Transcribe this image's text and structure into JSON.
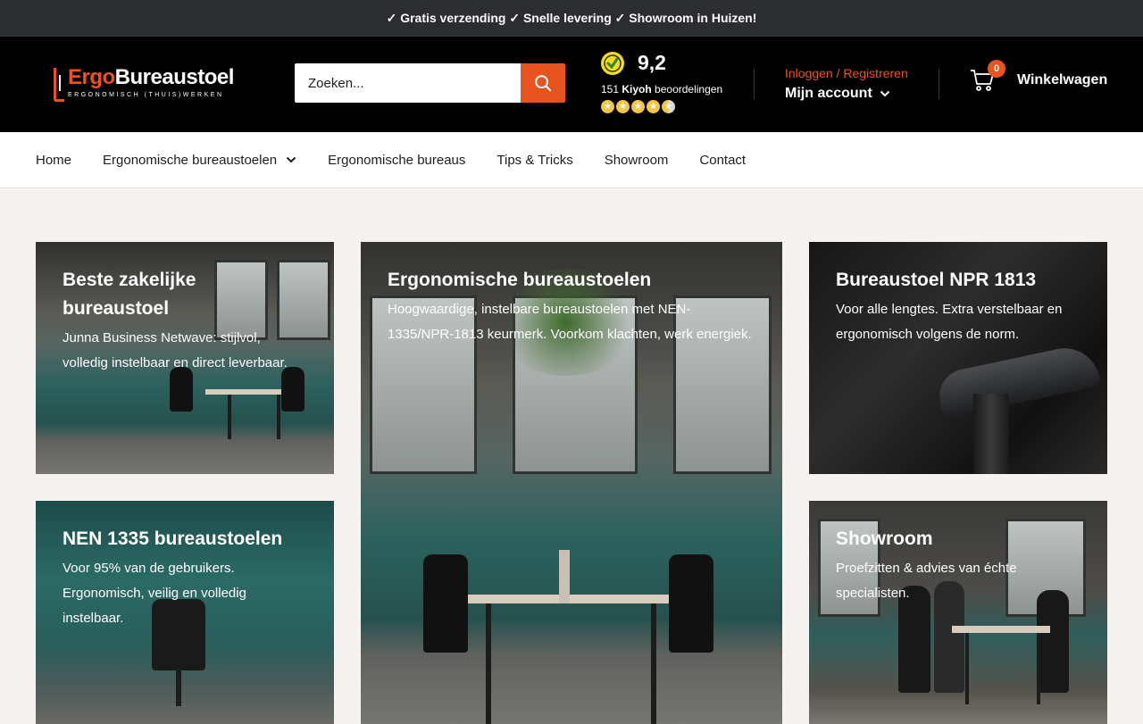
{
  "announcement": "✓ Gratis verzending ✓ Snelle levering ✓ Showroom in Huizen!",
  "logo": {
    "title_part1": "Ergo",
    "title_part2": "Bureaustoel",
    "tagline": "ERGONOMISCH (THUIS)WERKEN"
  },
  "search": {
    "placeholder": "Zoeken..."
  },
  "kiyoh": {
    "score": "9,2",
    "count": "151",
    "brand": "Kiyoh",
    "suffix": " beoordelingen",
    "stars": 4.5
  },
  "account": {
    "login": "Inloggen / Registreren",
    "label": "Mijn account"
  },
  "cart": {
    "count": "0",
    "label": "Winkelwagen"
  },
  "nav": [
    {
      "label": "Home"
    },
    {
      "label": "Ergonomische bureaustoelen"
    },
    {
      "label": "Ergonomische bureaus"
    },
    {
      "label": "Tips & Tricks"
    },
    {
      "label": "Showroom"
    },
    {
      "label": "Contact"
    }
  ],
  "tiles": [
    {
      "title": "Beste zakelijke bureaustoel",
      "desc": "Junna Business Netwave: stijlvol, volledig instelbaar en direct leverbaar."
    },
    {
      "title": "Ergonomische bureaustoelen",
      "desc": "Hoogwaardige, instelbare bureaustoelen met NEN-1335/NPR-1813 keurmerk. Voorkom klachten, werk energiek."
    },
    {
      "title": "Bureaustoel NPR 1813",
      "desc": "Voor alle lengtes. Extra verstelbaar en ergonomisch volgens de norm."
    },
    {
      "title": "NEN 1335 bureaustoelen",
      "desc": "Voor 95% van de gebruikers. Ergonomisch, veilig en volledig instelbaar."
    },
    {
      "title": "Showroom",
      "desc": "Proefzitten & advies van échte specialisten."
    }
  ],
  "colors": {
    "accent": "#e8541e",
    "header_bg": "#000000",
    "announce_bg": "#2b2d31",
    "page_bg": "#f5f2f0"
  },
  "icons": {
    "search": "search-icon",
    "cart": "cart-icon",
    "chevron": "chevron-down-icon",
    "kiyoh": "kiyoh-logo-icon"
  }
}
